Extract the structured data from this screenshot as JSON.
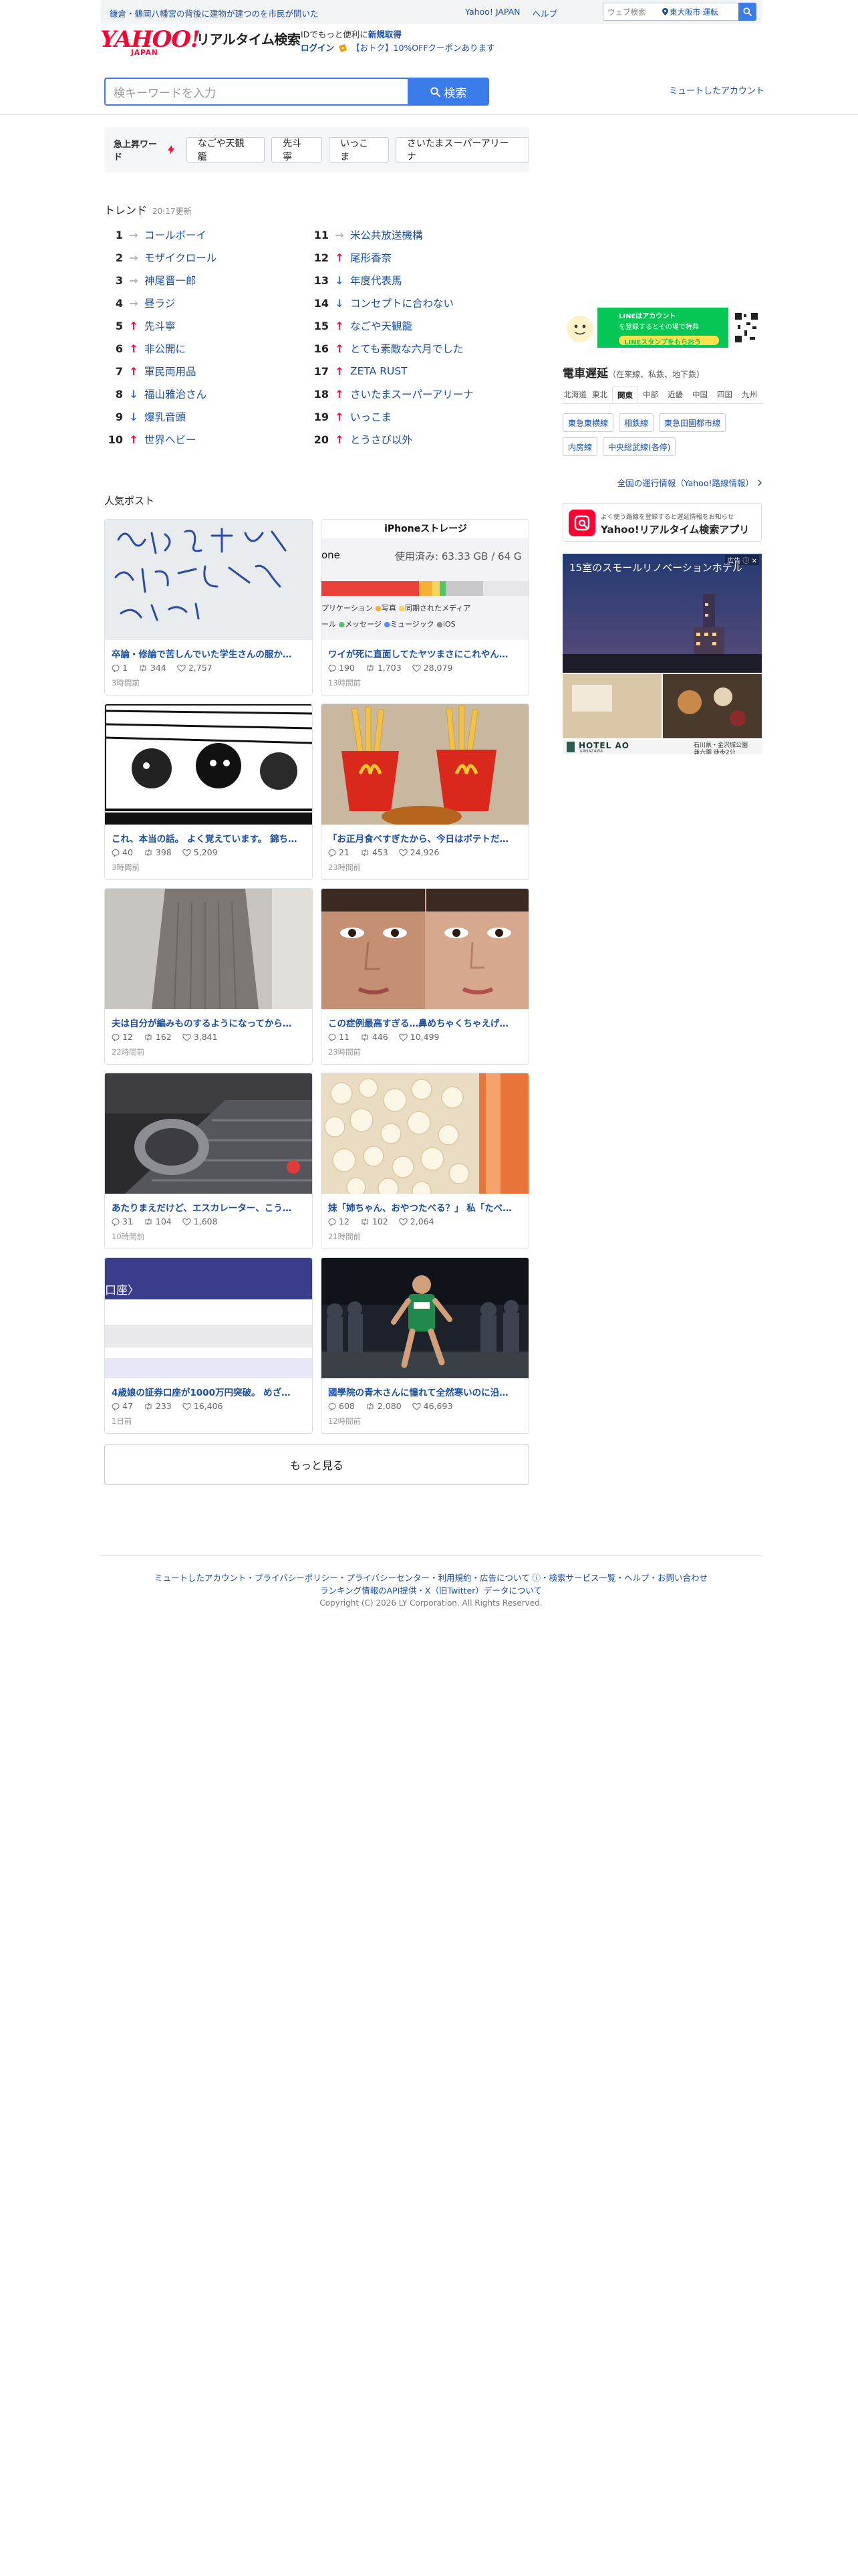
{
  "topbar": {
    "news": "鎌倉・鶴岡八幡宮の背後に建物が建つのを市民が問いた",
    "links": [
      "Yahoo! JAPAN",
      "ヘルプ"
    ],
    "web_search_placeholder": "ウェブ検索",
    "location": "東大阪市 運転",
    "search_icon": "search-icon"
  },
  "brand": {
    "logo_main": "YAHOO!",
    "logo_sub": "JAPAN",
    "product": "リアルタイム検索"
  },
  "promo": {
    "line1_text": "IDでもっと便利に",
    "line1_link": "新規取得",
    "login": "ログイン",
    "coupon": "【おトク】10%OFFクーポンあります"
  },
  "search": {
    "placeholder": "検キーワードを入力",
    "button": "検索",
    "muted_accounts": "ミュートしたアカウント"
  },
  "rising": {
    "label": "急上昇ワード",
    "words": [
      "なごや天観籠",
      "先斗寧",
      "いっこま",
      "さいたまスーパーアリーナ"
    ]
  },
  "trends": {
    "title": "トレンド",
    "updated": "20:17更新",
    "items": [
      {
        "rank": "1",
        "dir": "same",
        "word": "コールボーイ"
      },
      {
        "rank": "2",
        "dir": "same",
        "word": "モザイクロール"
      },
      {
        "rank": "3",
        "dir": "same",
        "word": "神尾晋一郎"
      },
      {
        "rank": "4",
        "dir": "same",
        "word": "昼ラジ"
      },
      {
        "rank": "5",
        "dir": "up",
        "word": "先斗寧"
      },
      {
        "rank": "6",
        "dir": "up",
        "word": "非公開に"
      },
      {
        "rank": "7",
        "dir": "up",
        "word": "軍民両用品"
      },
      {
        "rank": "8",
        "dir": "down",
        "word": "福山雅治さん"
      },
      {
        "rank": "9",
        "dir": "down",
        "word": "爆乳音頭"
      },
      {
        "rank": "10",
        "dir": "up",
        "word": "世界ヘビー"
      },
      {
        "rank": "11",
        "dir": "same",
        "word": "米公共放送機構"
      },
      {
        "rank": "12",
        "dir": "up",
        "word": "尾形香奈"
      },
      {
        "rank": "13",
        "dir": "down",
        "word": "年度代表馬"
      },
      {
        "rank": "14",
        "dir": "down",
        "word": "コンセプトに合わない"
      },
      {
        "rank": "15",
        "dir": "up",
        "word": "なごや天観籠"
      },
      {
        "rank": "16",
        "dir": "up",
        "word": "とても素敵な六月でした"
      },
      {
        "rank": "17",
        "dir": "up",
        "word": "ZETA RUST"
      },
      {
        "rank": "18",
        "dir": "up",
        "word": "さいたまスーパーアリーナ"
      },
      {
        "rank": "19",
        "dir": "up",
        "word": "いっこま"
      },
      {
        "rank": "20",
        "dir": "up",
        "word": "とうさび以外"
      }
    ]
  },
  "posts": {
    "title": "人気ポスト",
    "items": [
      {
        "title": "卒論・修論で苦しんでいた学生さんの服か…",
        "replies": "1",
        "reposts": "344",
        "likes": "2,757",
        "ago": "3時間前",
        "img": "note"
      },
      {
        "title": "ワイが死に直面してたヤツまさにこれやん…",
        "replies": "190",
        "reposts": "1,703",
        "likes": "28,079",
        "ago": "13時間前",
        "img": "storage",
        "img_title": "iPhoneストレージ",
        "img_used": "使用済み: 63.33 GB / 64 G",
        "img_prefix": "one",
        "img_legend_1": "プリケーション",
        "img_legend_2": "写真",
        "img_legend_3": "同期されたメディア",
        "img_legend_4": "ール",
        "img_legend_5": "メッセージ",
        "img_legend_6": "ミュージック",
        "img_legend_7": "iOS"
      },
      {
        "title": "これ、本当の話。 よく覚えています。 錦ち…",
        "replies": "40",
        "reposts": "398",
        "likes": "5,209",
        "ago": "3時間前",
        "img": "manga"
      },
      {
        "title": "「お正月食べすぎたから、今日はポテトだ…",
        "replies": "21",
        "reposts": "453",
        "likes": "24,926",
        "ago": "23時間前",
        "img": "fries"
      },
      {
        "title": "夫は自分が編みものするようになってから…",
        "replies": "12",
        "reposts": "162",
        "likes": "3,841",
        "ago": "22時間前",
        "img": "sweater"
      },
      {
        "title": "この症例最高すぎる…鼻めちゃくちゃえげ…",
        "replies": "11",
        "reposts": "446",
        "likes": "10,499",
        "ago": "23時間前",
        "img": "faces"
      },
      {
        "title": "あたりまえだけど、エスカレーター、こう…",
        "replies": "31",
        "reposts": "104",
        "likes": "1,608",
        "ago": "10時間前",
        "img": "escalator"
      },
      {
        "title": "妹「姉ちゃん、おやつたべる？」 私「たべ…",
        "replies": "12",
        "reposts": "102",
        "likes": "2,064",
        "ago": "21時間前",
        "img": "popcorn"
      },
      {
        "title": "4歳娘の証券口座が1000万円突破。 めざ…",
        "replies": "47",
        "reposts": "233",
        "likes": "16,406",
        "ago": "1日前",
        "img": "account",
        "img_title": "口座〉"
      },
      {
        "title": "國學院の青木さんに憧れて全然寒いのに沿…",
        "replies": "608",
        "reposts": "2,080",
        "likes": "46,693",
        "ago": "12時間前",
        "img": "runner"
      }
    ],
    "more": "もっと見る"
  },
  "sidebar": {
    "line_banner_l1": "LINEはアカウント",
    "line_banner_l2": "を登録するとその場で特典",
    "line_banner_l3": "LINEスタンプをもらおう",
    "train_title": "電車遅延",
    "train_sub": "（在来線、私鉄、地下鉄）",
    "regions": [
      "北海道",
      "東北",
      "関東",
      "中部",
      "近畿",
      "中国",
      "四国",
      "九州"
    ],
    "active_region": "関東",
    "lines": [
      "東急東横線",
      "相鉄線",
      "東急田園都市線",
      "内房線",
      "中央総武線(各停)"
    ],
    "all_train": "全国の運行情報（Yahoo!路線情報）",
    "app_banner_l1": "よく使う路線を登録すると遅延情報をお知らせ",
    "app_banner_l2": "Yahoo!リアルタイム検索アプリ",
    "ad_label": "広告 ⓘ ✕",
    "ad_headline": "15室のスモールリノベーションホテル",
    "ad_hotel": "HOTEL AO",
    "ad_hotel_sub": "KANAZAWA",
    "ad_info_1": "石川県・金沢城公園",
    "ad_info_2": "兼六園 徒歩2分"
  },
  "footer": {
    "links_line1": "ミュートしたアカウント・プライバシーポリシー・プライバシーセンター・利用規約・広告について ⓘ・検索サービス一覧・ヘルプ・お問い合わせ",
    "links_line2": "ランキング情報のAPI提供・X（旧Twitter）データについて",
    "copyright": "Copyright (C) 2026 LY Corporation. All Rights Reserved."
  },
  "colors": {
    "brand_red": "#ff0033",
    "link_blue": "#1a4fa3",
    "accent_blue": "#3b7bea",
    "up_arrow": "#ff0033",
    "down_arrow": "#2d6ad8",
    "same_arrow": "#b0b4ba"
  }
}
